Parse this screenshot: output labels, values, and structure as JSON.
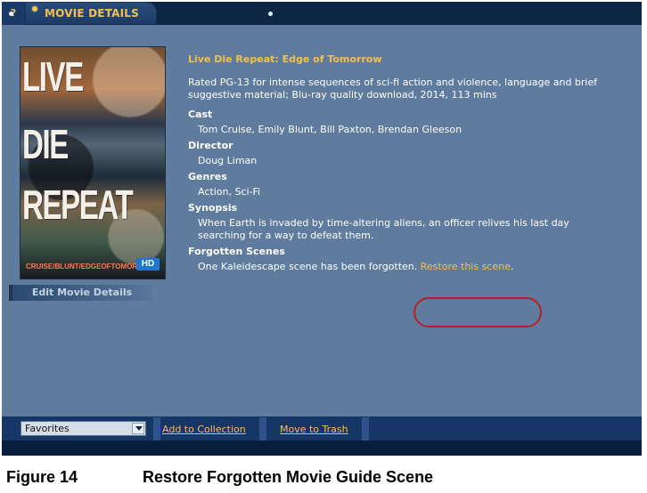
{
  "ui": {
    "header": {
      "help_label": "?",
      "tab_label": "MOVIE DETAILS"
    },
    "poster": {
      "lines": [
        "LIVE",
        "DIE",
        "REPEAT"
      ],
      "credit": "CRUISE/BLUNT/EDGEOFTOMORROW",
      "badge": "HD"
    },
    "edit_button_label": "Edit Movie Details",
    "details": {
      "title": "Live Die Repeat: Edge of Tomorrow",
      "rating": "Rated PG-13 for intense sequences of sci-fi action and violence, language and brief suggestive material; Blu-ray quality download, 2014, 113 mins",
      "cast_heading": "Cast",
      "cast_value": "Tom Cruise, Emily Blunt, Bill Paxton, Brendan Gleeson",
      "director_heading": "Director",
      "director_value": "Doug Liman",
      "genres_heading": "Genres",
      "genres_value": "Action, Sci-Fi",
      "synopsis_heading": "Synopsis",
      "synopsis_value": "When Earth is invaded by time-altering aliens, an officer relives his last day searching for a way to defeat them.",
      "forgotten_heading": "Forgotten Scenes",
      "forgotten_text": "One Kaleidescape scene has been forgotten.",
      "restore_link": "Restore this scene",
      "restore_suffix": "."
    },
    "bottom": {
      "favorites_value": "Favorites",
      "add_link": "Add to Collection",
      "trash_link": "Move to Trash"
    },
    "colors": {
      "accent": "#f3c14b",
      "panel": "#5f7c9e",
      "highlight_ring": "#b42020"
    }
  },
  "caption": {
    "label": "Figure 14",
    "text": "Restore Forgotten Movie Guide Scene"
  }
}
